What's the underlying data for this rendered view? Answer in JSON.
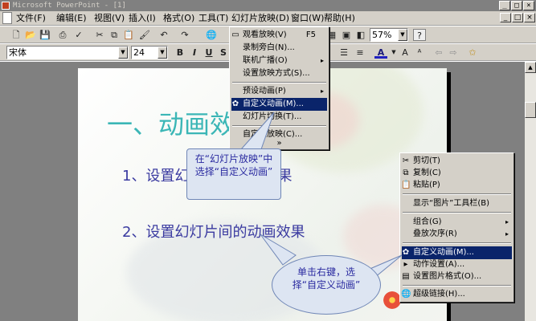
{
  "window": {
    "title": "Microsoft PowerPoint - [1]",
    "controls": [
      "_",
      "□",
      "×"
    ]
  },
  "menubar": {
    "items": [
      "文件(F)",
      "编辑(E)",
      "视图(V)",
      "插入(I)",
      "格式(O)",
      "工具(T)",
      "幻灯片放映(D)",
      "窗口(W)",
      "帮助(H)"
    ]
  },
  "doc_controls": [
    "_",
    "□",
    "×"
  ],
  "toolbar": {
    "zoom": "57%",
    "help": "?"
  },
  "formatting": {
    "font": "宋体",
    "size": "24",
    "bold": "B",
    "italic": "I",
    "underline": "U",
    "shadow": "S",
    "font_color": "A"
  },
  "slide": {
    "title": "一、动画效",
    "line1": "1、设置幻",
    "line1_tail": "动画效果",
    "line2": "2、设置幻灯片间的动画效果"
  },
  "show_menu": {
    "items": [
      {
        "label": "观看放映(V)",
        "shortcut": "F5",
        "icon": "projector-icon"
      },
      {
        "label": "录制旁白(N)...",
        "shortcut": ""
      },
      {
        "label": "联机广播(O)",
        "submenu": "▸"
      },
      {
        "label": "设置放映方式(S)...",
        "shortcut": ""
      },
      {
        "label": "预设动画(P)",
        "submenu": "▸"
      },
      {
        "label": "自定义动画(M)...",
        "selected": true,
        "icon": "animation-icon"
      },
      {
        "label": "幻灯片切换(T)...",
        "shortcut": ""
      },
      {
        "label": "自定义放映(C)...",
        "shortcut": ""
      },
      {
        "label": "»",
        "shortcut": ""
      }
    ]
  },
  "context_menu": {
    "items": [
      {
        "label": "剪切(T)",
        "icon": "scissors-icon"
      },
      {
        "label": "复制(C)",
        "icon": "copy-icon"
      },
      {
        "label": "粘贴(P)",
        "icon": "paste-icon"
      },
      {
        "label": "显示“图片”工具栏(B)"
      },
      {
        "label": "组合(G)",
        "submenu": "▸"
      },
      {
        "label": "叠放次序(R)",
        "submenu": "▸"
      },
      {
        "label": "自定义动画(M)...",
        "selected": true,
        "icon": "animation-icon"
      },
      {
        "label": "动作设置(A)...",
        "icon": "action-icon"
      },
      {
        "label": "设置图片格式(O)...",
        "icon": "format-picture-icon"
      },
      {
        "label": "超级链接(H)...",
        "icon": "hyperlink-icon"
      }
    ]
  },
  "callouts": {
    "a": "在“幻灯片放映”中选择“自定义动画”",
    "b": "单击右键，选择“自定义动画”"
  }
}
